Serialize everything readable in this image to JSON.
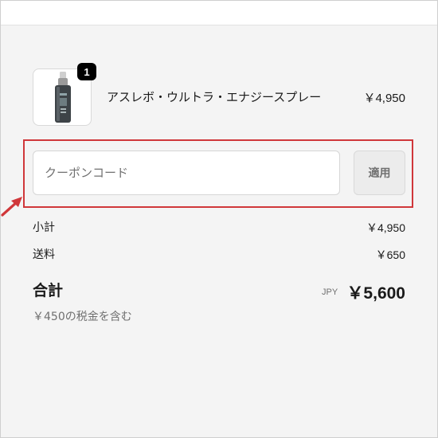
{
  "cart": {
    "items": [
      {
        "name": "アスレボ・ウルトラ・エナジースプレー",
        "price": "￥4,950",
        "quantity": "1",
        "image_icon": "spray-bottle-icon"
      }
    ]
  },
  "coupon": {
    "placeholder": "クーポンコード",
    "value": "",
    "apply_label": "適用"
  },
  "summary": {
    "subtotal_label": "小計",
    "subtotal_value": "￥4,950",
    "shipping_label": "送料",
    "shipping_value": "￥650",
    "total_label": "合計",
    "currency": "JPY",
    "total_value": "￥5,600",
    "tax_note": "￥450の税金を含む"
  },
  "colors": {
    "highlight": "#d0373a",
    "panel_bg": "#f4f4f4",
    "badge_bg": "#000000"
  }
}
